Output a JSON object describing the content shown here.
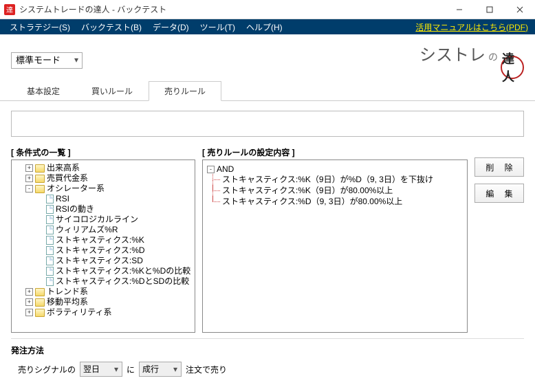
{
  "window": {
    "title": "システムトレードの達人 - バックテスト"
  },
  "menubar": {
    "items": [
      "ストラテジー(S)",
      "バックテスト(B)",
      "データ(D)",
      "ツール(T)",
      "ヘルプ(H)"
    ],
    "link": "活用マニュアルはこちら(PDF)"
  },
  "mode_select": "標準モード",
  "logo": {
    "text": "シストレ",
    "small": "の",
    "circle": "達人"
  },
  "tabs": {
    "items": [
      "基本設定",
      "買いルール",
      "売りルール"
    ],
    "active_index": 2
  },
  "cond_list": {
    "label": "[ 条件式の一覧 ]",
    "nodes": [
      {
        "type": "folder",
        "toggle": "+",
        "label": "出来高系",
        "level": 0
      },
      {
        "type": "folder",
        "toggle": "+",
        "label": "売買代金系",
        "level": 0
      },
      {
        "type": "folder",
        "toggle": "-",
        "label": "オシレーター系",
        "level": 0
      },
      {
        "type": "doc",
        "label": "RSI",
        "level": 1
      },
      {
        "type": "doc",
        "label": "RSIの動き",
        "level": 1
      },
      {
        "type": "doc",
        "label": "サイコロジカルライン",
        "level": 1
      },
      {
        "type": "doc",
        "label": "ウィリアムズ%R",
        "level": 1
      },
      {
        "type": "doc",
        "label": "ストキャスティクス:%K",
        "level": 1
      },
      {
        "type": "doc",
        "label": "ストキャスティクス:%D",
        "level": 1
      },
      {
        "type": "doc",
        "label": "ストキャスティクス:SD",
        "level": 1
      },
      {
        "type": "doc",
        "label": "ストキャスティクス:%Kと%Dの比較",
        "level": 1
      },
      {
        "type": "doc",
        "label": "ストキャスティクス:%DとSDの比較",
        "level": 1
      },
      {
        "type": "folder",
        "toggle": "+",
        "label": "トレンド系",
        "level": 0
      },
      {
        "type": "folder",
        "toggle": "+",
        "label": "移動平均系",
        "level": 0
      },
      {
        "type": "folder",
        "toggle": "+",
        "label": "ボラティリティ系",
        "level": 0
      }
    ]
  },
  "rule": {
    "label": "[ 売りルールの設定内容 ]",
    "root": "AND",
    "toggle": "-",
    "items": [
      "ストキャスティクス:%K（9日）が%D（9, 3日）を下抜け",
      "ストキャスティクス:%K（9日）が80.00%以上",
      "ストキャスティクス:%D（9, 3日）が80.00%以上"
    ]
  },
  "buttons": {
    "delete": "削 除",
    "edit": "編 集"
  },
  "order": {
    "title": "発注方法",
    "signal_of": "売りシグナルの",
    "day": "翌日",
    "ni": "に",
    "type": "成行",
    "suffix": "注文で売り"
  }
}
